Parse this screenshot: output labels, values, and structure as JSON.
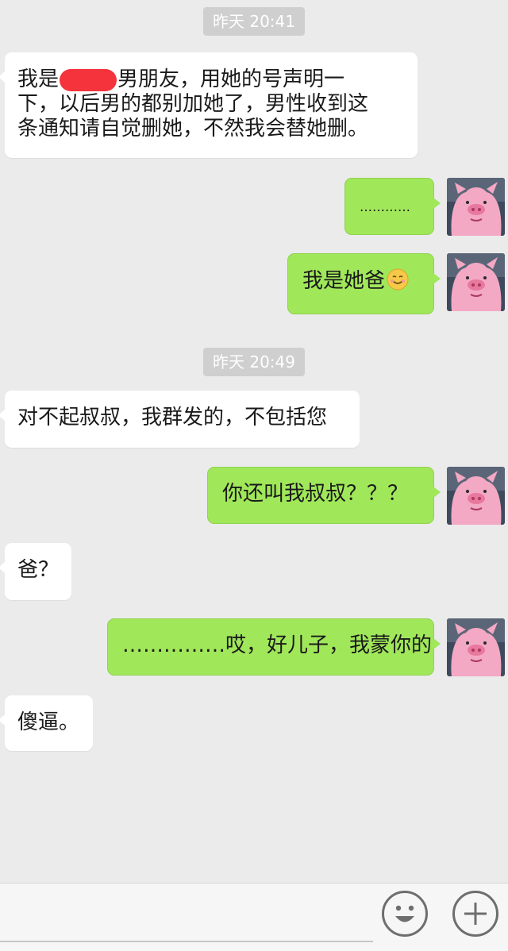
{
  "timestamps": [
    "昨天 20:41",
    "昨天 20:49"
  ],
  "messages": {
    "m1": {
      "prefix": "我是",
      "line1_rest": "男朋友，用她的号声明一",
      "line2": "下，以后男的都别加她了，男性收到这",
      "line3": "条通知请自觉删她，不然我会替她删。"
    },
    "m2": "…………",
    "m3": "我是她爸",
    "m4": "对不起叔叔，我群发的，不包括您",
    "m5": "你还叫我叔叔？？？",
    "m6": "爸？",
    "m7": "……………哎，好儿子，我蒙你的",
    "m8": "傻逼。"
  },
  "icons": {
    "avatar": "pink-pig-avatar-icon",
    "emoji": "smiling-face-emoji-icon",
    "emoji_button": "smiley-face-icon",
    "more_button": "plus-icon"
  },
  "colors": {
    "background": "#ebebeb",
    "incoming_bubble": "#ffffff",
    "outgoing_bubble": "#a0e75a",
    "timestamp_bg": "#cfcfcf",
    "redaction": "#f4333c"
  }
}
